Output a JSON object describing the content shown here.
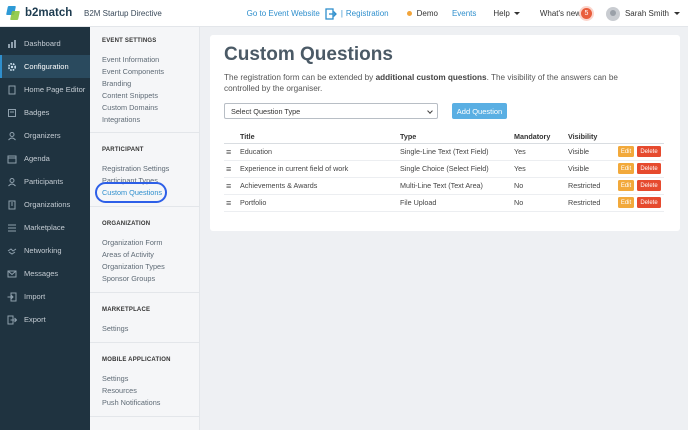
{
  "topbar": {
    "logo_text": "b2match",
    "event_name": "B2M Startup Directive",
    "goto_website": "Go to Event Website",
    "registration": "Registration",
    "separator": "|",
    "demo": "Demo",
    "events": "Events",
    "help": "Help",
    "whats_new": "What's new",
    "whats_new_count": "5",
    "user_name": "Sarah Smith",
    "accent_color": "#2f8fcd"
  },
  "sidebar": {
    "items": [
      {
        "label": "Dashboard",
        "icon": "dashboard-icon"
      },
      {
        "label": "Configuration",
        "icon": "gear-icon"
      },
      {
        "label": "Home Page Editor",
        "icon": "page-icon"
      },
      {
        "label": "Badges",
        "icon": "badge-icon"
      },
      {
        "label": "Organizers",
        "icon": "users-icon"
      },
      {
        "label": "Agenda",
        "icon": "calendar-icon"
      },
      {
        "label": "Participants",
        "icon": "users-icon"
      },
      {
        "label": "Organizations",
        "icon": "building-icon"
      },
      {
        "label": "Marketplace",
        "icon": "list-icon"
      },
      {
        "label": "Networking",
        "icon": "handshake-icon"
      },
      {
        "label": "Messages",
        "icon": "mail-icon"
      },
      {
        "label": "Import",
        "icon": "import-icon"
      },
      {
        "label": "Export",
        "icon": "export-icon"
      }
    ]
  },
  "submenu": {
    "event_settings": {
      "heading": "EVENT SETTINGS",
      "links": [
        "Event Information",
        "Event Components",
        "Branding",
        "Content Snippets",
        "Custom Domains",
        "Integrations"
      ]
    },
    "participant": {
      "heading": "PARTICIPANT",
      "links": [
        "Registration Settings",
        "Participant Types",
        "Custom Questions"
      ]
    },
    "organization": {
      "heading": "ORGANIZATION",
      "links": [
        "Organization Form",
        "Areas of Activity",
        "Organization Types",
        "Sponsor Groups"
      ]
    },
    "marketplace": {
      "heading": "MARKETPLACE",
      "links": [
        "Settings"
      ]
    },
    "mobile": {
      "heading": "MOBILE APPLICATION",
      "links": [
        "Settings",
        "Resources",
        "Push Notifications"
      ]
    }
  },
  "main": {
    "title": "Custom Questions",
    "desc_1": "The registration form can be extended by ",
    "desc_bold": "additional custom questions",
    "desc_2": ". The visibility of the answers can be controlled by the organiser.",
    "select_placeholder": "Select Question Type",
    "add_button": "Add Question",
    "columns": [
      "Title",
      "Type",
      "Mandatory",
      "Visibility"
    ],
    "edit_label": "Edit",
    "delete_label": "Delete",
    "drag_glyph": "≡",
    "rows": [
      {
        "title": "Education",
        "type": "Single-Line Text (Text Field)",
        "mandatory": "Yes",
        "visibility": "Visible"
      },
      {
        "title": "Experience in current field of work",
        "type": "Single Choice (Select Field)",
        "mandatory": "Yes",
        "visibility": "Visible"
      },
      {
        "title": "Achievements & Awards",
        "type": "Multi-Line Text (Text Area)",
        "mandatory": "No",
        "visibility": "Restricted"
      },
      {
        "title": "Portfolio",
        "type": "File Upload",
        "mandatory": "No",
        "visibility": "Restricted"
      }
    ]
  }
}
